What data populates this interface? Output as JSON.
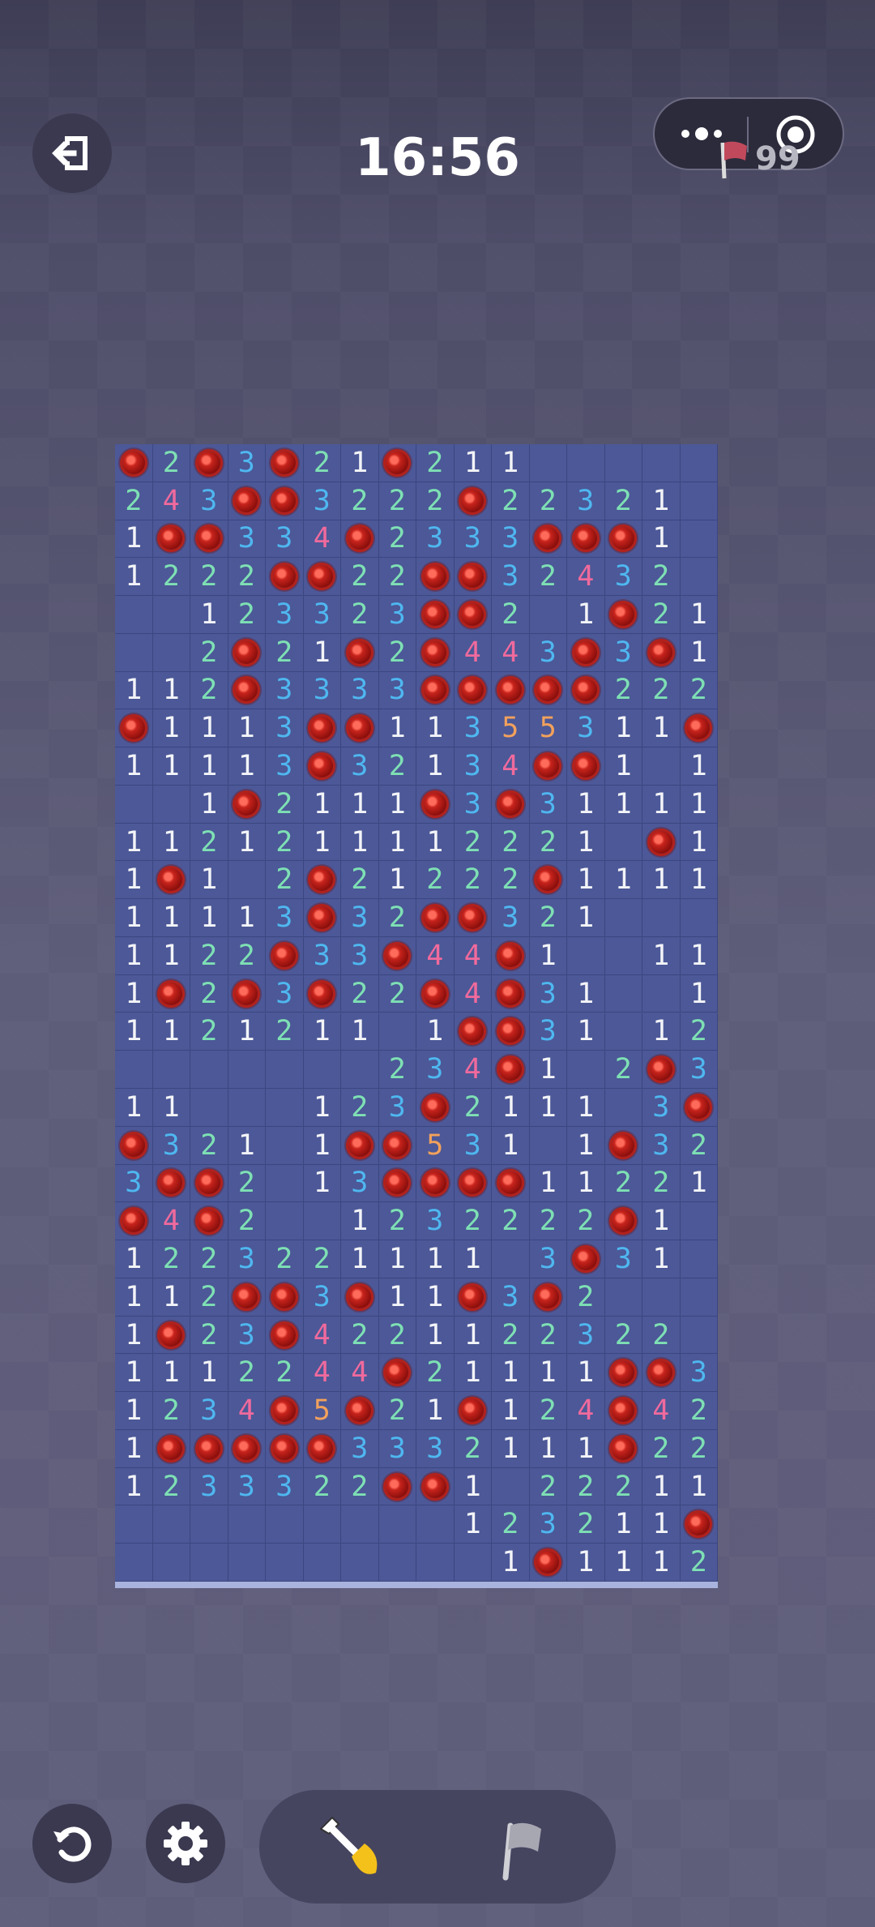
{
  "header": {
    "time": "16:56",
    "flag_count": "99"
  },
  "icons": {
    "back": "exit-icon",
    "more": "more-dots-icon",
    "target": "target-icon",
    "flag": "flag-icon",
    "restart": "restart-icon",
    "settings": "gear-icon",
    "dig": "shovel-icon",
    "flag_tool": "flag-tool-icon"
  },
  "colors": {
    "board": "#4c5897",
    "n1": "#f3f4f8",
    "n2": "#7ee0b4",
    "n3": "#4fb7f0",
    "n4": "#f06a9d",
    "n5": "#f2a15c",
    "mine": "#c7231c"
  },
  "board": {
    "cols": 16,
    "rows": 30,
    "grid": [
      "M2M3M21M211",
      "243MM3222M22321",
      "1MM334M2333MMM1",
      "1222MM22MM32432",
      "  123323MM2 1M21",
      "  2M21M2M443M3M1",
      "112M3333MMMMM222",
      "M1113MM11355311M",
      "11113M32134MM1 11",
      "  1M2111M3M31111",
      "1121211112221 M1",
      "1M1 2M21222M1111",
      "11113M32MM321",
      "1122M33M44M1  11",
      "1M2M3M22M4M31  1M",
      "1121211 1MM31 122",
      "       234M1 2M3",
      "11   123M2111 3MM",
      "M321 1MM531 1M32",
      "3MM2 13MMMM11221",
      "M4M2  1232222M1",
      "1223221111 3M31",
      "112MM3M11M3M2",
      "1M23M4221122322 1",
      "1112244M21111MM3M",
      "1234M5M21M124M42",
      "1MMMMM3332111M22M",
      "1233322MM1 22211",
      "         123211M211",
      "          1M1112M1"
    ]
  }
}
